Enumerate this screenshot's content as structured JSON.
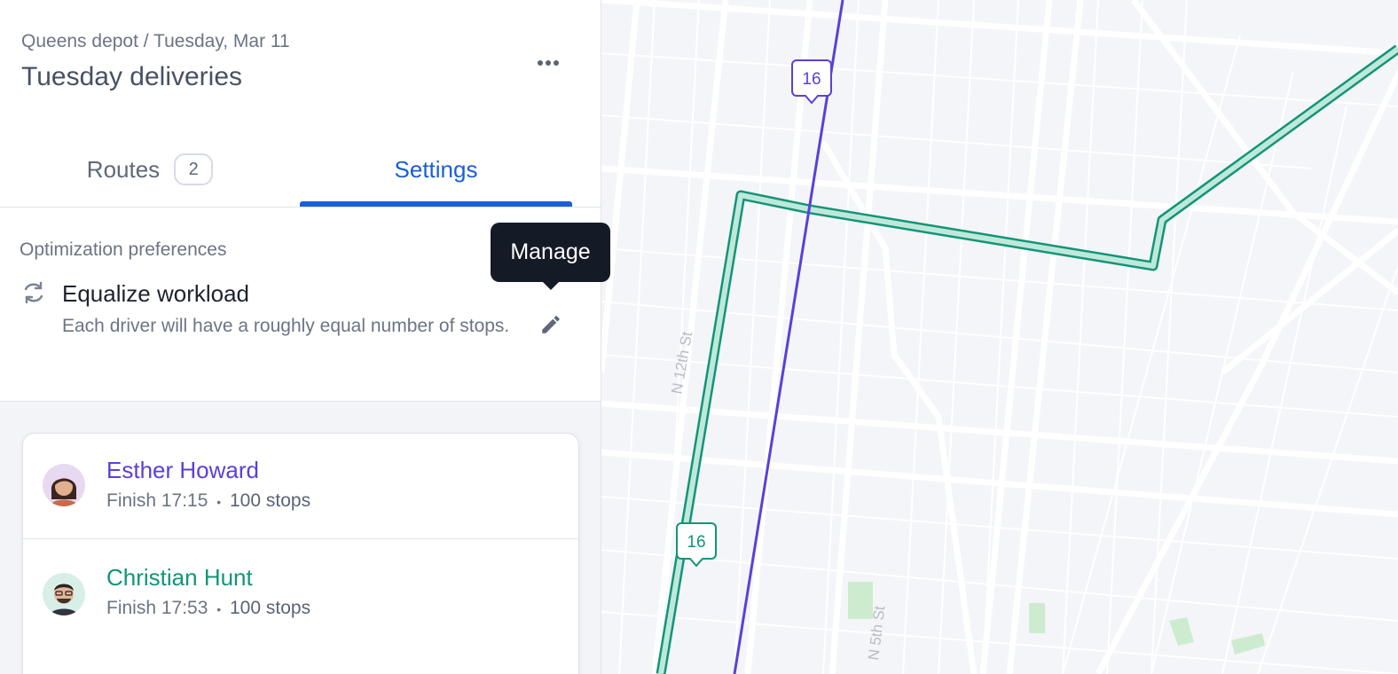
{
  "header": {
    "breadcrumb": "Queens depot / Tuesday, Mar 11",
    "title": "Tuesday deliveries",
    "more_icon": "more-horizontal-icon"
  },
  "tabs": {
    "routes_label": "Routes",
    "routes_count": "2",
    "settings_label": "Settings",
    "active": "Settings"
  },
  "preferences": {
    "section_label": "Optimization preferences",
    "name": "Equalize workload",
    "description": "Each driver will have a roughly equal number of stops.",
    "icon": "refresh-icon",
    "edit_icon": "pencil-icon",
    "tooltip": "Manage"
  },
  "drivers": [
    {
      "name": "Esther Howard",
      "finish": "Finish 17:15",
      "separator": "•",
      "stops": "100 stops",
      "color": "#5b3fd9"
    },
    {
      "name": "Christian Hunt",
      "finish": "Finish 17:53",
      "separator": "•",
      "stops": "100 stops",
      "color": "#119578"
    }
  ],
  "map": {
    "streets": [
      "N 12th St",
      "N 5th St"
    ],
    "markers": [
      {
        "label": "16",
        "route": "Esther Howard",
        "color": "#5b3fd9"
      },
      {
        "label": "16",
        "route": "Christian Hunt",
        "color": "#119578"
      }
    ]
  },
  "colors": {
    "accent": "#1a5fd6",
    "route_purple": "#5b3fd9",
    "route_green": "#119578",
    "tooltip_bg": "#141a26"
  }
}
